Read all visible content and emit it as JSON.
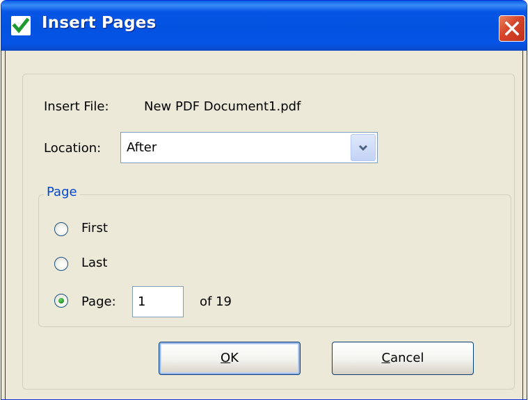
{
  "window": {
    "title": "Insert Pages",
    "close_label": "Close"
  },
  "form": {
    "insert_file_label": "Insert File:",
    "insert_file_value": "New PDF Document1.pdf",
    "location_label": "Location:",
    "location_value": "After"
  },
  "page_group": {
    "legend": "Page",
    "options": [
      {
        "label": "First",
        "selected": false
      },
      {
        "label": "Last",
        "selected": false
      },
      {
        "label": "Page:",
        "selected": true
      }
    ],
    "page_number": "1",
    "of_total": "of 19"
  },
  "buttons": {
    "ok_mnemonic": "O",
    "ok_rest": "K",
    "cancel_mnemonic": "C",
    "cancel_rest": "ancel"
  },
  "colors": {
    "titlebar": "#0655e4",
    "dialog_bg": "#ece9d8",
    "group_legend": "#0046d5",
    "close_button": "#d6432a"
  },
  "icons": {
    "app": "green-checkmark-icon",
    "close": "close-x-icon",
    "dropdown": "chevron-down-icon"
  }
}
